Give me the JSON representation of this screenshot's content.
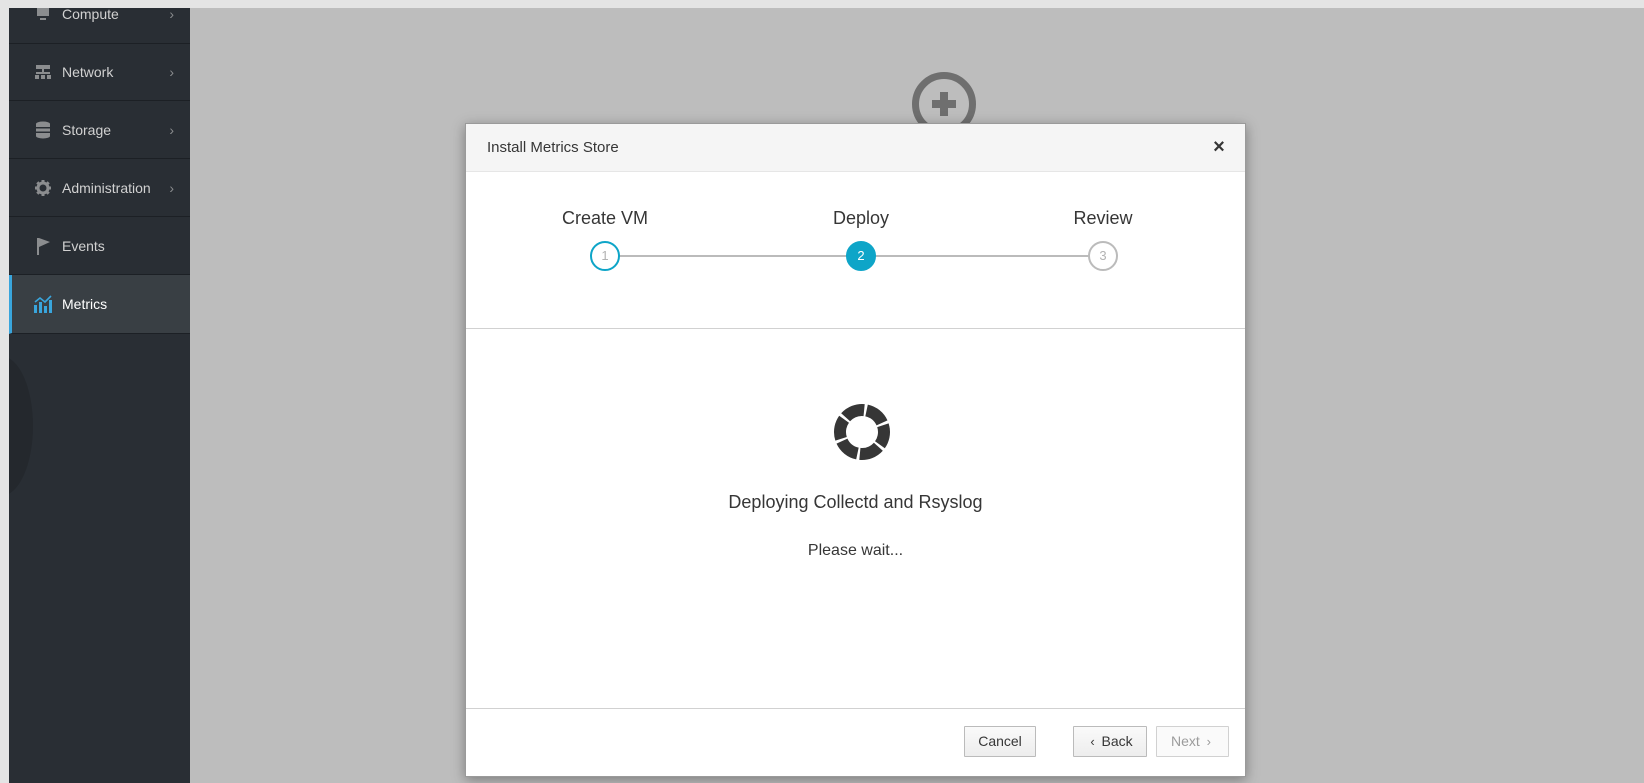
{
  "sidebar": {
    "items": [
      {
        "label": "Compute",
        "icon": "compute-icon",
        "chevron": "›"
      },
      {
        "label": "Network",
        "icon": "network-icon",
        "chevron": "›"
      },
      {
        "label": "Storage",
        "icon": "storage-icon",
        "chevron": "›"
      },
      {
        "label": "Administration",
        "icon": "gear-icon",
        "chevron": "›"
      },
      {
        "label": "Events",
        "icon": "flag-icon"
      },
      {
        "label": "Metrics",
        "icon": "metrics-icon",
        "active": true
      }
    ]
  },
  "modal": {
    "title": "Install Metrics Store",
    "close": "×",
    "steps": [
      {
        "label": "Create VM",
        "number": "1",
        "state": "done"
      },
      {
        "label": "Deploy",
        "number": "2",
        "state": "current"
      },
      {
        "label": "Review",
        "number": "3",
        "state": "todo"
      }
    ],
    "status_text": "Deploying Collectd and Rsyslog",
    "wait_text": "Please wait...",
    "buttons": {
      "cancel": "Cancel",
      "back": "Back",
      "next": "Next",
      "back_arrow": "‹",
      "next_arrow": "›"
    }
  },
  "colors": {
    "accent": "#0ea5c8",
    "sidebar_bg": "#292e34",
    "active_bar": "#39a5dc"
  }
}
